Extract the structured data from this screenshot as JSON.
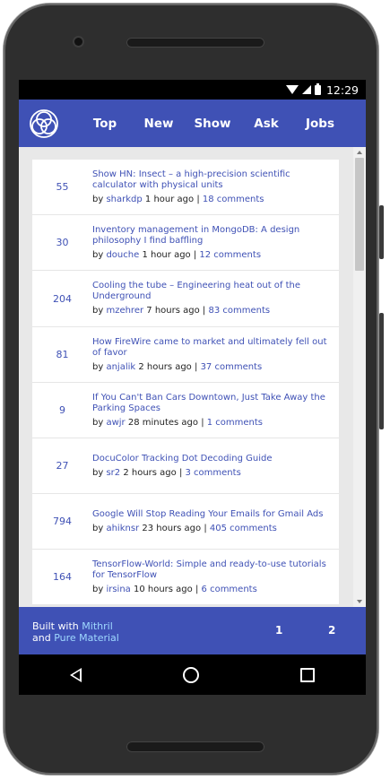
{
  "status": {
    "time": "12:29"
  },
  "nav": [
    "Top",
    "New",
    "Show",
    "Ask",
    "Jobs"
  ],
  "stories": [
    {
      "points": "55",
      "title": "Show HN: Insect – a high-precision scientific calculator with physical units",
      "by": "by",
      "user": "sharkdp",
      "time": "1 hour ago",
      "sep": "|",
      "comments": "18 comments"
    },
    {
      "points": "30",
      "title": "Inventory management in MongoDB: A design philosophy I find baffling",
      "by": "by",
      "user": "douche",
      "time": "1 hour ago",
      "sep": "|",
      "comments": "12 comments"
    },
    {
      "points": "204",
      "title": "Cooling the tube – Engineering heat out of the Underground",
      "by": "by",
      "user": "mzehrer",
      "time": "7 hours ago",
      "sep": "|",
      "comments": "83 comments"
    },
    {
      "points": "81",
      "title": "How FireWire came to market and ultimately fell out of favor",
      "by": "by",
      "user": "anjalik",
      "time": "2 hours ago",
      "sep": "|",
      "comments": "37 comments"
    },
    {
      "points": "9",
      "title": "If You Can't Ban Cars Downtown, Just Take Away the Parking Spaces",
      "by": "by",
      "user": "awjr",
      "time": "28 minutes ago",
      "sep": "|",
      "comments": "1 comments"
    },
    {
      "points": "27",
      "title": "DocuColor Tracking Dot Decoding Guide",
      "by": "by",
      "user": "sr2",
      "time": "2 hours ago",
      "sep": "|",
      "comments": "3 comments"
    },
    {
      "points": "794",
      "title": "Google Will Stop Reading Your Emails for Gmail Ads",
      "by": "by",
      "user": "ahiknsr",
      "time": "23 hours ago",
      "sep": "|",
      "comments": "405 comments"
    },
    {
      "points": "164",
      "title": "TensorFlow-World: Simple and ready-to-use tutorials for TensorFlow",
      "by": "by",
      "user": "irsina",
      "time": "10 hours ago",
      "sep": "|",
      "comments": "6 comments"
    }
  ],
  "footer": {
    "built_prefix": "Built with",
    "mithril": "Mithril",
    "and_text": "and",
    "pure_material": "Pure Material",
    "pages": [
      "1",
      "2"
    ]
  },
  "colors": {
    "primary": "#3f51b5",
    "footer_link": "#9fd9ff"
  }
}
